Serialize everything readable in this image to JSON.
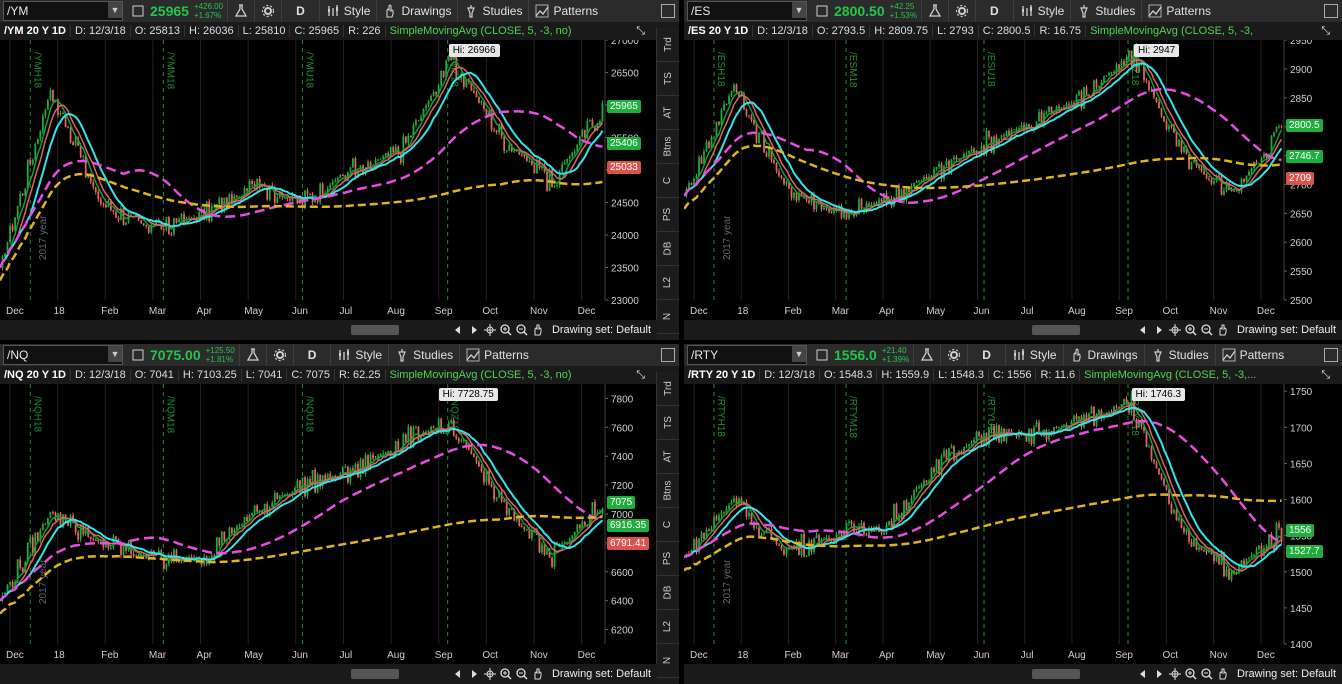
{
  "panels": [
    {
      "symbol": "/YM",
      "price": "25965",
      "change": "+426.00",
      "change_pct": "+1.67%",
      "toolbar": [
        "D",
        "Style",
        "Drawings",
        "Studies",
        "Patterns"
      ],
      "info": {
        "title": "/YM 20 Y 1D",
        "date": "D: 12/3/18",
        "open": "O: 25813",
        "high": "H: 26036",
        "low": "L: 25810",
        "close": "C: 25965",
        "range": "R: 226",
        "study": "SimpleMovingAvg (CLOSE, 5, -3, no)"
      },
      "hi_label": "Hi: 26966",
      "yticks": [
        "27000",
        "26500",
        "26000",
        "25500",
        "25000",
        "24500",
        "24000",
        "23500",
        "23000"
      ],
      "xticks": [
        "Dec",
        "18",
        "Feb",
        "Mar",
        "Apr",
        "May",
        "Jun",
        "Jul",
        "Aug",
        "Sep",
        "Oct",
        "Nov",
        "Dec"
      ],
      "price_tags": [
        {
          "v": "25965",
          "c": "#1fae3d"
        },
        {
          "v": "25406",
          "c": "#1fae3d"
        },
        {
          "v": "25033",
          "c": "#d9534f"
        }
      ],
      "drawing_set": "Drawing set: Default",
      "side_tabs": [
        "Trd",
        "TS",
        "AT",
        "Btns",
        "C",
        "PS",
        "DB",
        "L2",
        "N"
      ],
      "contract_labels": [
        "/YMH18",
        "/YMM18",
        "/YMU18",
        "/YMZ18"
      ],
      "year_label": "2017 year"
    },
    {
      "symbol": "/ES",
      "price": "2800.50",
      "change": "+42.25",
      "change_pct": "+1.53%",
      "toolbar": [
        "D",
        "Style",
        "Studies",
        "Patterns"
      ],
      "info": {
        "title": "/ES 20 Y 1D",
        "date": "D: 12/3/18",
        "open": "O: 2793.5",
        "high": "H: 2809.75",
        "low": "L: 2793",
        "close": "C: 2800.5",
        "range": "R: 16.75",
        "study": "SimpleMovingAvg (CLOSE, 5, -3,"
      },
      "hi_label": "Hi: 2947",
      "yticks": [
        "2950",
        "2900",
        "2850",
        "2800",
        "2750",
        "2700",
        "2650",
        "2600",
        "2550",
        "2500"
      ],
      "xticks": [
        "Dec",
        "18",
        "Feb",
        "Mar",
        "Apr",
        "May",
        "Jun",
        "Jul",
        "Aug",
        "Sep",
        "Oct",
        "Nov",
        "Dec"
      ],
      "price_tags": [
        {
          "v": "2800.5",
          "c": "#1fae3d"
        },
        {
          "v": "2746.7",
          "c": "#1fae3d"
        },
        {
          "v": "2709",
          "c": "#d9534f"
        }
      ],
      "drawing_set": "Drawing set: Default",
      "contract_labels": [
        "/ESH18",
        "/ESM18",
        "/ESU18",
        "/ESZ18"
      ],
      "year_label": "2017 year"
    },
    {
      "symbol": "/NQ",
      "price": "7075.00",
      "change": "+125.50",
      "change_pct": "+1.81%",
      "toolbar": [
        "D",
        "Style",
        "Studies",
        "Patterns"
      ],
      "info": {
        "title": "/NQ 20 Y 1D",
        "date": "D: 12/3/18",
        "open": "O: 7041",
        "high": "H: 7103.25",
        "low": "L: 7041",
        "close": "C: 7075",
        "range": "R: 62.25",
        "study": "SimpleMovingAvg (CLOSE, 5, -3, no)"
      },
      "hi_label": "Hi: 7728.75",
      "yticks": [
        "7800",
        "7600",
        "7400",
        "7200",
        "7000",
        "6800",
        "6600",
        "6400",
        "6200"
      ],
      "xticks": [
        "Dec",
        "18",
        "Feb",
        "Mar",
        "Apr",
        "May",
        "Jun",
        "Jul",
        "Aug",
        "Sep",
        "Oct",
        "Nov",
        "Dec"
      ],
      "price_tags": [
        {
          "v": "7075",
          "c": "#1fae3d"
        },
        {
          "v": "6916.35",
          "c": "#1fae3d"
        },
        {
          "v": "6791.41",
          "c": "#d9534f"
        }
      ],
      "drawing_set": "Drawing set: Default",
      "side_tabs": [
        "Trd",
        "TS",
        "AT",
        "Btns",
        "C",
        "PS",
        "DB",
        "L2",
        "N"
      ],
      "contract_labels": [
        "/NQH18",
        "/NQM18",
        "/NQU18",
        "/NQZ18"
      ],
      "year_label": "2017 year"
    },
    {
      "symbol": "/RTY",
      "price": "1556.0",
      "change": "+21.40",
      "change_pct": "+1.39%",
      "toolbar": [
        "D",
        "Style",
        "Drawings",
        "Studies",
        "Patterns"
      ],
      "info": {
        "title": "/RTY 20 Y 1D",
        "date": "D: 12/3/18",
        "open": "O: 1548.3",
        "high": "H: 1559.9",
        "low": "L: 1548.3",
        "close": "C: 1556",
        "range": "R: 11.6",
        "study": "SimpleMovingAvg (CLOSE, 5, -3,..."
      },
      "hi_label": "Hi: 1746.3",
      "yticks": [
        "1750",
        "1700",
        "1650",
        "1600",
        "1550",
        "1500",
        "1450",
        "1400"
      ],
      "xticks": [
        "Dec",
        "18",
        "Feb",
        "Mar",
        "Apr",
        "May",
        "Jun",
        "Jul",
        "Aug",
        "Sep",
        "Oct",
        "Nov",
        "Dec"
      ],
      "price_tags": [
        {
          "v": "1556",
          "c": "#1fae3d"
        },
        {
          "v": "1527.7",
          "c": "#1fae3d"
        }
      ],
      "drawing_set": "Drawing set: Default",
      "contract_labels": [
        "/RTYH18",
        "/RTYM18",
        "/RTYU18",
        "/RTYZ18"
      ],
      "year_label": "2017 year"
    }
  ],
  "colors": {
    "up": "#1fae3d",
    "down": "#e2685f",
    "sma_cyan": "#2fe6ee",
    "sma_pink": "#e84ce4",
    "sma_yellow": "#e0b320",
    "bg": "#000000",
    "toolbar": "#2b2b2b",
    "accent_green": "#23c44b"
  },
  "chart_data": [
    {
      "type": "line",
      "title": "/YM 20 Y 1D",
      "x": [
        "Dec",
        "18",
        "Feb",
        "Mar",
        "Apr",
        "May",
        "Jun",
        "Jul",
        "Aug",
        "Sep",
        "Oct",
        "Nov",
        "Dec"
      ],
      "series": [
        {
          "name": "/YM",
          "values": [
            23500,
            26200,
            24500,
            24100,
            24300,
            24700,
            24500,
            25000,
            25300,
            26700,
            25500,
            24800,
            25965
          ]
        }
      ],
      "ylim": [
        23000,
        27000
      ]
    },
    {
      "type": "line",
      "title": "/ES 20 Y 1D",
      "x": [
        "Dec",
        "18",
        "Feb",
        "Mar",
        "Apr",
        "May",
        "Jun",
        "Jul",
        "Aug",
        "Sep",
        "Oct",
        "Nov",
        "Dec"
      ],
      "series": [
        {
          "name": "/ES",
          "values": [
            2680,
            2870,
            2700,
            2650,
            2670,
            2720,
            2770,
            2810,
            2850,
            2930,
            2750,
            2680,
            2800.5
          ]
        }
      ],
      "ylim": [
        2500,
        2950
      ]
    },
    {
      "type": "line",
      "title": "/NQ 20 Y 1D",
      "x": [
        "Dec",
        "18",
        "Feb",
        "Mar",
        "Apr",
        "May",
        "Jun",
        "Jul",
        "Aug",
        "Sep",
        "Oct",
        "Nov",
        "Dec"
      ],
      "series": [
        {
          "name": "/NQ",
          "values": [
            6400,
            7000,
            6800,
            6700,
            6700,
            7000,
            7200,
            7300,
            7500,
            7650,
            7050,
            6700,
            7075
          ]
        }
      ],
      "ylim": [
        6100,
        7900
      ]
    },
    {
      "type": "line",
      "title": "/RTY 20 Y 1D",
      "x": [
        "Dec",
        "18",
        "Feb",
        "Mar",
        "Apr",
        "May",
        "Jun",
        "Jul",
        "Aug",
        "Sep",
        "Oct",
        "Nov",
        "Dec"
      ],
      "series": [
        {
          "name": "/RTY",
          "values": [
            1520,
            1600,
            1530,
            1550,
            1560,
            1640,
            1690,
            1690,
            1710,
            1730,
            1550,
            1500,
            1556
          ]
        }
      ],
      "ylim": [
        1400,
        1760
      ]
    }
  ]
}
